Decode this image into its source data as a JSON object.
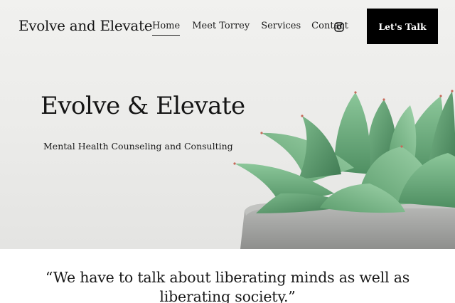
{
  "header": {
    "site_title": "Evolve and Elevate",
    "nav": {
      "home": "Home",
      "meet": "Meet Torrey",
      "services": "Services",
      "contact": "Contact"
    },
    "social_icon": "instagram-icon",
    "cta_label": "Let's Talk"
  },
  "hero": {
    "title": "Evolve & Elevate",
    "subtitle": "Mental Health Counseling and Consulting",
    "image": "succulent-plant-in-concrete-pot"
  },
  "quote": {
    "text": "“We have to talk about liberating minds as well as liberating society.”"
  },
  "colors": {
    "hero_background": "#ededeb",
    "cta_background": "#000000",
    "cta_text": "#ffffff",
    "text": "#1a1a1a",
    "leaf": "#6aa97a"
  }
}
